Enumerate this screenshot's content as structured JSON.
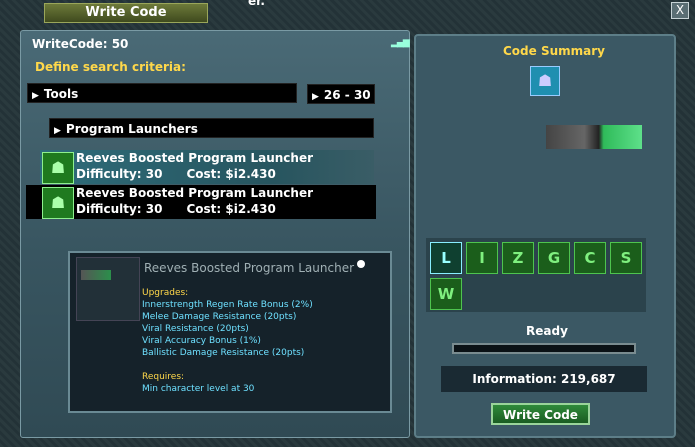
{
  "window": {
    "title": "Write Code",
    "title_extra": "er.",
    "close_label": "X"
  },
  "left": {
    "writecode_level": "WriteCode: 50",
    "signal_icon": "signal-bars",
    "criteria_label": "Define search criteria:",
    "category": "Tools",
    "range": "26 - 30",
    "subcategory": "Program Launchers",
    "items": [
      {
        "name": "Reeves Boosted Program Launcher",
        "difficulty": "Difficulty: 30",
        "cost": "Cost: $i2.430",
        "icon": "mask-icon"
      },
      {
        "name": "Reeves Boosted Program Launcher",
        "difficulty": "Difficulty: 30",
        "cost": "Cost: $i2.430",
        "icon": "mask-icon"
      }
    ]
  },
  "tooltip": {
    "title": "Reeves Boosted Program Launcher",
    "upgrades_head": "Upgrades:",
    "upgrades": [
      "Innerstrength Regen Rate Bonus (2%)",
      "Melee Damage Resistance (20pts)",
      "Viral Resistance (20pts)",
      "Viral Accuracy Bonus (1%)",
      "Ballistic Damage Resistance (20pts)"
    ],
    "requires_head": "Requires:",
    "requires": "Min character level at 30"
  },
  "right": {
    "summary_title": "Code Summary",
    "ready_label": "Ready",
    "information": "Information: 219,687",
    "write_button": "Write Code",
    "progress": 0,
    "slots": [
      "L",
      "I",
      "Z",
      "G",
      "C",
      "S",
      "W"
    ]
  }
}
